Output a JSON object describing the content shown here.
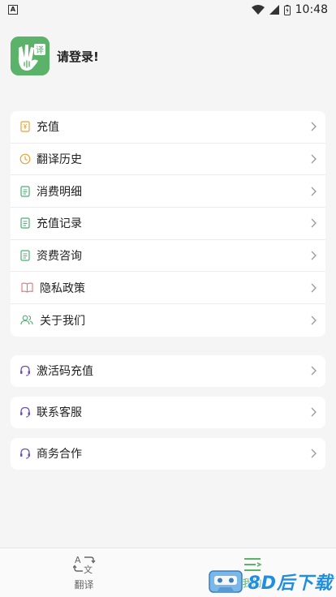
{
  "status_bar": {
    "left_badge": "A",
    "time": "10:48",
    "icons": [
      "wifi-icon",
      "signal-icon",
      "battery-icon"
    ]
  },
  "profile": {
    "login_text": "请登录!",
    "logo_badge": "译"
  },
  "menu_main": [
    {
      "label": "充值",
      "icon": "recharge-icon",
      "color": "#e8a23a"
    },
    {
      "label": "翻译历史",
      "icon": "clock-icon",
      "color": "#e8a23a"
    },
    {
      "label": "消费明细",
      "icon": "document-icon",
      "color": "#4caf73"
    },
    {
      "label": "充值记录",
      "icon": "document-icon",
      "color": "#4caf73"
    },
    {
      "label": "资费咨询",
      "icon": "document-icon",
      "color": "#4caf73"
    },
    {
      "label": "隐私政策",
      "icon": "book-icon",
      "color": "#e57373"
    },
    {
      "label": "关于我们",
      "icon": "people-icon",
      "color": "#4caf73"
    }
  ],
  "menu_singles": [
    {
      "label": "激活码充值",
      "icon": "headset-icon",
      "color": "#6a4fc9"
    },
    {
      "label": "联系客服",
      "icon": "headset-icon",
      "color": "#6a4fc9"
    },
    {
      "label": "商务合作",
      "icon": "headset-icon",
      "color": "#6a4fc9"
    }
  ],
  "bottom_nav": {
    "translate_label": "翻译",
    "mine_label": "我的",
    "active": "mine"
  },
  "watermark": {
    "text": "8D后下载"
  },
  "colors": {
    "brand_green": "#5bb36a",
    "background": "#f5f5f5",
    "watermark_blue": "#1f8ee0"
  }
}
